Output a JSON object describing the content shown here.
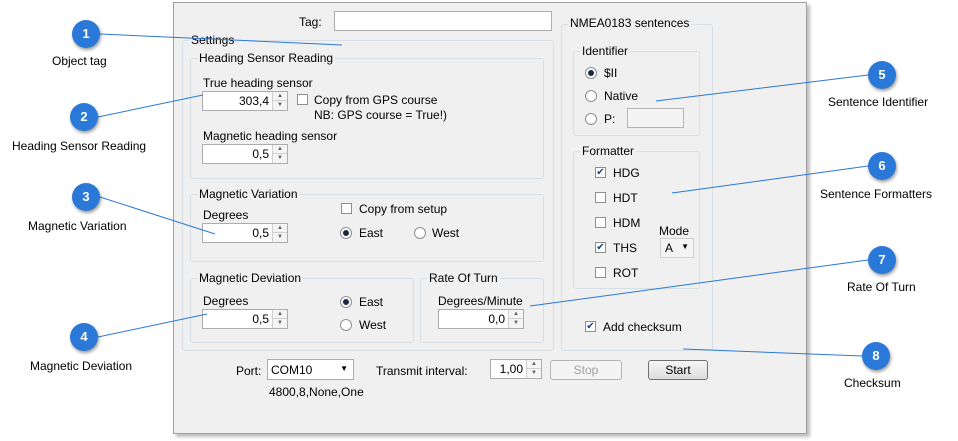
{
  "form": {
    "tag_label": "Tag:",
    "tag_value": "",
    "settings_title": "Settings",
    "heading_title": "Heading Sensor Reading",
    "true_heading_label": "True heading sensor",
    "true_heading_value": "303,4",
    "copy_gps_label": "Copy from GPS course",
    "copy_gps_note": "NB: GPS course = True!)",
    "magnetic_heading_label": "Magnetic heading sensor",
    "magnetic_heading_value": "0,5",
    "variation_title": "Magnetic Variation",
    "variation_degrees_label": "Degrees",
    "variation_value": "0,5",
    "copy_setup_label": "Copy from setup",
    "variation_east": "East",
    "variation_west": "West",
    "deviation_title": "Magnetic Deviation",
    "deviation_degrees_label": "Degrees",
    "deviation_value": "0,5",
    "deviation_east": "East",
    "deviation_west": "West",
    "rot_title": "Rate Of Turn",
    "rot_label": "Degrees/Minute",
    "rot_value": "0,0",
    "nmea_title": "NMEA0183 sentences",
    "identifier_title": "Identifier",
    "id_ii": "$II",
    "id_native": "Native",
    "id_p": "P:",
    "id_p_value": "",
    "formatter_title": "Formatter",
    "fmt_hdg": "HDG",
    "fmt_hdt": "HDT",
    "fmt_hdm": "HDM",
    "fmt_ths": "THS",
    "fmt_rot": "ROT",
    "mode_label": "Mode",
    "mode_value": "A",
    "checksum_label": "Add checksum",
    "port_label": "Port:",
    "port_value": "COM10",
    "port_settings": "4800,8,None,One",
    "interval_label": "Transmit interval:",
    "interval_value": "1,00",
    "stop_label": "Stop",
    "start_label": "Start"
  },
  "callouts": [
    {
      "num": "1",
      "label": "Object tag"
    },
    {
      "num": "2",
      "label": "Heading Sensor Reading"
    },
    {
      "num": "3",
      "label": "Magnetic Variation"
    },
    {
      "num": "4",
      "label": "Magnetic Deviation"
    },
    {
      "num": "5",
      "label": "Sentence Identifier"
    },
    {
      "num": "6",
      "label": "Sentence Formatters"
    },
    {
      "num": "7",
      "label": "Rate Of Turn"
    },
    {
      "num": "8",
      "label": "Checksum"
    }
  ],
  "colors": {
    "badge": "#2a78d8",
    "callout_line": "#2a78d8",
    "panel": "#f0f0f0"
  }
}
